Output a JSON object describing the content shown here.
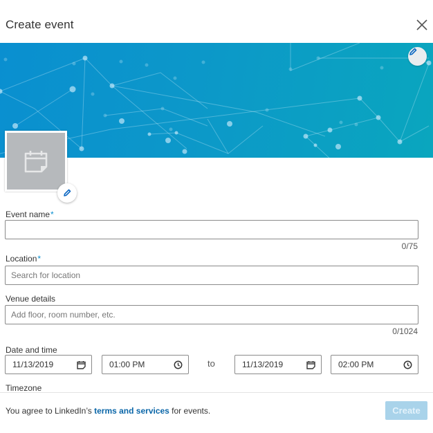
{
  "header": {
    "title": "Create event",
    "close_icon": "close-icon"
  },
  "banner": {
    "edit_icon": "pencil-icon",
    "accent": "#0a8fd0"
  },
  "logo": {
    "icon": "calendar-icon",
    "edit_icon": "pencil-icon"
  },
  "form": {
    "event_name": {
      "label": "Event name",
      "required_mark": "*",
      "value": "",
      "placeholder": "",
      "counter": "0/75"
    },
    "location": {
      "label": "Location",
      "required_mark": "*",
      "value": "",
      "placeholder": "Search for location"
    },
    "venue": {
      "label": "Venue details",
      "value": "",
      "placeholder": "Add floor, room number, etc.",
      "counter": "0/1024"
    },
    "datetime": {
      "label": "Date and time",
      "start_date": "11/13/2019",
      "start_time": "01:00 PM",
      "to_label": "to",
      "end_date": "11/13/2019",
      "end_time": "02:00 PM"
    },
    "timezone": {
      "label": "Timezone"
    }
  },
  "footer": {
    "agree_prefix": "You agree to LinkedIn’s ",
    "agree_link": "terms and services",
    "agree_suffix": " for events.",
    "create_label": "Create",
    "create_enabled": false
  }
}
